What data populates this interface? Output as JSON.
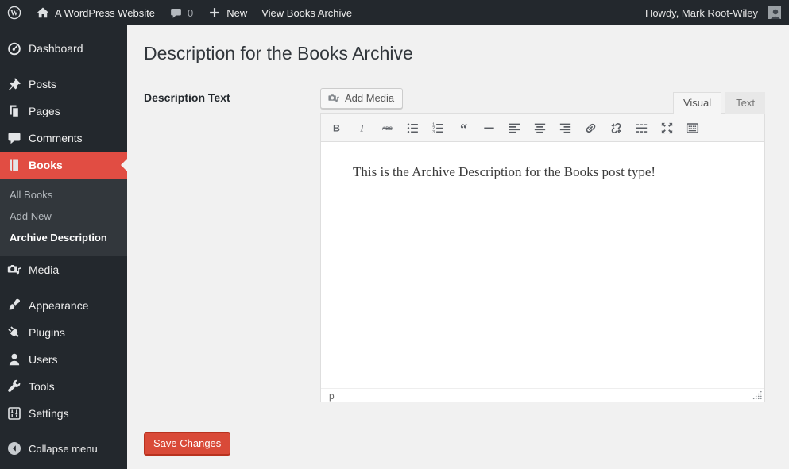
{
  "admin_bar": {
    "site_name": "A WordPress Website",
    "comments_count": "0",
    "new_label": "New",
    "view_link_label": "View Books Archive",
    "howdy_label": "Howdy, Mark Root-Wiley"
  },
  "sidebar": {
    "menu": [
      {
        "label": "Dashboard",
        "icon": "dashboard-icon"
      },
      {
        "separator": true
      },
      {
        "label": "Posts",
        "icon": "pushpin-icon"
      },
      {
        "label": "Pages",
        "icon": "pages-icon"
      },
      {
        "label": "Comments",
        "icon": "comment-icon"
      },
      {
        "label": "Books",
        "icon": "book-icon",
        "active": true,
        "submenu": [
          {
            "label": "All Books"
          },
          {
            "label": "Add New"
          },
          {
            "label": "Archive Description",
            "current": true
          }
        ]
      },
      {
        "label": "Media",
        "icon": "media-icon"
      },
      {
        "separator": true
      },
      {
        "label": "Appearance",
        "icon": "brush-icon"
      },
      {
        "label": "Plugins",
        "icon": "plug-icon"
      },
      {
        "label": "Users",
        "icon": "user-icon"
      },
      {
        "label": "Tools",
        "icon": "wrench-icon"
      },
      {
        "label": "Settings",
        "icon": "settings-icon"
      }
    ],
    "collapse_label": "Collapse menu"
  },
  "main": {
    "page_title": "Description for the Books Archive",
    "field_label": "Description Text",
    "editor": {
      "add_media_label": "Add Media",
      "tabs": [
        {
          "label": "Visual",
          "active": true
        },
        {
          "label": "Text",
          "active": false
        }
      ],
      "toolbar_icons": [
        "bold",
        "italic",
        "strikethrough",
        "bullet-list",
        "numbered-list",
        "blockquote",
        "horizontal-rule",
        "align-left",
        "align-center",
        "align-right",
        "link",
        "unlink",
        "read-more",
        "fullscreen",
        "toolbar-toggle"
      ],
      "content_text": "This is the Archive Description for the Books post type!",
      "status_path": "p"
    },
    "save_button_label": "Save Changes"
  },
  "colors": {
    "admin_bar_bg": "#23282d",
    "submenu_bg": "#32373c",
    "active_menu_bg": "#e14d43",
    "page_bg": "#f1f1f1",
    "button_primary_bg": "#d94a38",
    "button_primary_border": "#b8321f"
  }
}
